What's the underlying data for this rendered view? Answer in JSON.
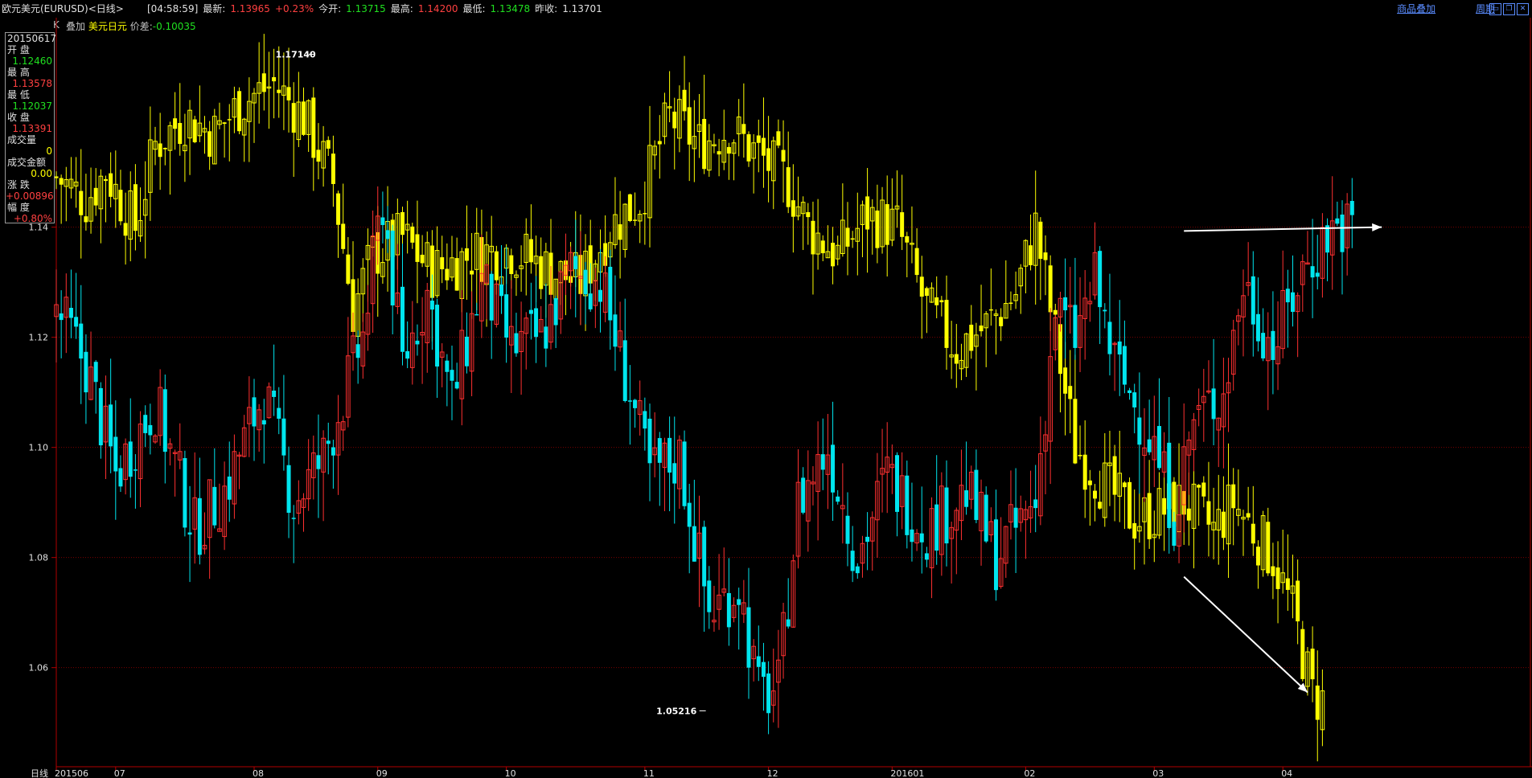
{
  "header": {
    "title": "欧元美元(EURUSD)<日线>",
    "time": "[04:58:59]",
    "latest_label": "最新:",
    "latest": "1.13965",
    "change_pct": "+0.23%",
    "open_label": "今开:",
    "open": "1.13715",
    "high_label": "最高:",
    "high": "1.14200",
    "low_label": "最低:",
    "low": "1.13478",
    "prev_label": "昨收:",
    "prev": "1.13701",
    "link_overlay": "商品叠加",
    "link_period": "周期"
  },
  "overlay": {
    "k_label": "K",
    "overlay_label": "叠加",
    "overlay_name": "美元日元",
    "spread_label": "价差:",
    "spread": "-0.10035"
  },
  "infobox": {
    "date": "20150617",
    "rows": [
      {
        "label": "开  盘",
        "value": "1.12460",
        "color": "#20e020"
      },
      {
        "label": "最  高",
        "value": "1.13578",
        "color": "#ff4040"
      },
      {
        "label": "最  低",
        "value": "1.12037",
        "color": "#20e020"
      },
      {
        "label": "收  盘",
        "value": "1.13391",
        "color": "#ff4040"
      },
      {
        "label": "成交量",
        "value": "0",
        "color": "#ffff00"
      },
      {
        "label": "成交金额",
        "value": "0.00",
        "color": "#ffff00"
      },
      {
        "label": "涨  跌",
        "value": "+0.00896",
        "color": "#ff4040"
      },
      {
        "label": "幅  度",
        "value": "+0.80%",
        "color": "#ff4040"
      }
    ]
  },
  "chart_data": {
    "type": "candlestick",
    "title": "",
    "ylim": [
      1.042,
      1.176
    ],
    "y_ticks": [
      1.06,
      1.08,
      1.1,
      1.12,
      1.14
    ],
    "y_tick_labels": [
      "1.06",
      "1.08",
      "1.10",
      "1.12",
      "1.14"
    ],
    "x_tick_labels": [
      {
        "label": "日线",
        "index": -1
      },
      {
        "label": "201506",
        "index": 0
      },
      {
        "label": "07",
        "index": 12
      },
      {
        "label": "08",
        "index": 40
      },
      {
        "label": "09",
        "index": 65
      },
      {
        "label": "10",
        "index": 91
      },
      {
        "label": "11",
        "index": 119
      },
      {
        "label": "12",
        "index": 144
      },
      {
        "label": "201601",
        "index": 169
      },
      {
        "label": "02",
        "index": 196
      },
      {
        "label": "03",
        "index": 222
      },
      {
        "label": "04",
        "index": 248
      }
    ],
    "grid": true,
    "annotations": [
      {
        "text": "1.17140",
        "value": 1.1714
      },
      {
        "text": "1.05216",
        "value": 1.05216
      }
    ],
    "colors": {
      "up": "#ff3030",
      "down": "#00e5ee",
      "overlay": "#ffff00",
      "grid": "#7a0000",
      "axis": "#b00000"
    },
    "series": [
      {
        "name": "欧元美元"
      },
      {
        "name": "美元日元"
      }
    ],
    "anchors_main": [
      [
        0,
        1.125
      ],
      [
        6,
        1.115
      ],
      [
        12,
        1.095
      ],
      [
        20,
        1.108
      ],
      [
        28,
        1.085
      ],
      [
        34,
        1.092
      ],
      [
        42,
        1.11
      ],
      [
        48,
        1.09
      ],
      [
        54,
        1.098
      ],
      [
        62,
        1.12
      ],
      [
        66,
        1.145
      ],
      [
        70,
        1.115
      ],
      [
        75,
        1.128
      ],
      [
        80,
        1.108
      ],
      [
        86,
        1.13
      ],
      [
        92,
        1.118
      ],
      [
        98,
        1.12
      ],
      [
        104,
        1.132
      ],
      [
        110,
        1.13
      ],
      [
        116,
        1.11
      ],
      [
        120,
        1.095
      ],
      [
        126,
        1.098
      ],
      [
        132,
        1.07
      ],
      [
        138,
        1.075
      ],
      [
        142,
        1.055
      ],
      [
        146,
        1.056
      ],
      [
        150,
        1.09
      ],
      [
        156,
        1.1
      ],
      [
        162,
        1.08
      ],
      [
        168,
        1.095
      ],
      [
        176,
        1.085
      ],
      [
        184,
        1.092
      ],
      [
        190,
        1.08
      ],
      [
        198,
        1.09
      ],
      [
        202,
        1.125
      ],
      [
        206,
        1.12
      ],
      [
        210,
        1.13
      ],
      [
        214,
        1.115
      ],
      [
        218,
        1.108
      ],
      [
        222,
        1.1
      ],
      [
        226,
        1.088
      ],
      [
        230,
        1.105
      ],
      [
        236,
        1.11
      ],
      [
        240,
        1.13
      ],
      [
        246,
        1.118
      ],
      [
        252,
        1.132
      ],
      [
        258,
        1.14
      ],
      [
        262,
        1.14
      ]
    ],
    "anchors_overlay": [
      [
        0,
        1.149
      ],
      [
        6,
        1.145
      ],
      [
        10,
        1.15
      ],
      [
        16,
        1.14
      ],
      [
        20,
        1.155
      ],
      [
        26,
        1.16
      ],
      [
        32,
        1.157
      ],
      [
        38,
        1.163
      ],
      [
        44,
        1.166
      ],
      [
        50,
        1.16
      ],
      [
        56,
        1.148
      ],
      [
        60,
        1.125
      ],
      [
        64,
        1.135
      ],
      [
        70,
        1.138
      ],
      [
        76,
        1.132
      ],
      [
        84,
        1.135
      ],
      [
        92,
        1.136
      ],
      [
        100,
        1.132
      ],
      [
        106,
        1.13
      ],
      [
        112,
        1.14
      ],
      [
        118,
        1.145
      ],
      [
        124,
        1.16
      ],
      [
        130,
        1.155
      ],
      [
        136,
        1.158
      ],
      [
        142,
        1.153
      ],
      [
        148,
        1.148
      ],
      [
        152,
        1.14
      ],
      [
        158,
        1.135
      ],
      [
        164,
        1.142
      ],
      [
        170,
        1.14
      ],
      [
        176,
        1.125
      ],
      [
        182,
        1.118
      ],
      [
        188,
        1.122
      ],
      [
        194,
        1.128
      ],
      [
        198,
        1.14
      ],
      [
        202,
        1.12
      ],
      [
        206,
        1.1
      ],
      [
        212,
        1.093
      ],
      [
        218,
        1.087
      ],
      [
        222,
        1.088
      ],
      [
        228,
        1.09
      ],
      [
        234,
        1.085
      ],
      [
        238,
        1.09
      ],
      [
        242,
        1.085
      ],
      [
        246,
        1.08
      ],
      [
        250,
        1.07
      ],
      [
        254,
        1.055
      ],
      [
        256,
        1.054
      ]
    ],
    "arrows": [
      {
        "from": {
          "index": 228,
          "value": 1.1393
        },
        "to": {
          "index": 268,
          "value": 1.14
        }
      },
      {
        "from": {
          "index": 228,
          "value": 1.0765
        },
        "to": {
          "index": 253,
          "value": 1.0555
        }
      }
    ]
  }
}
